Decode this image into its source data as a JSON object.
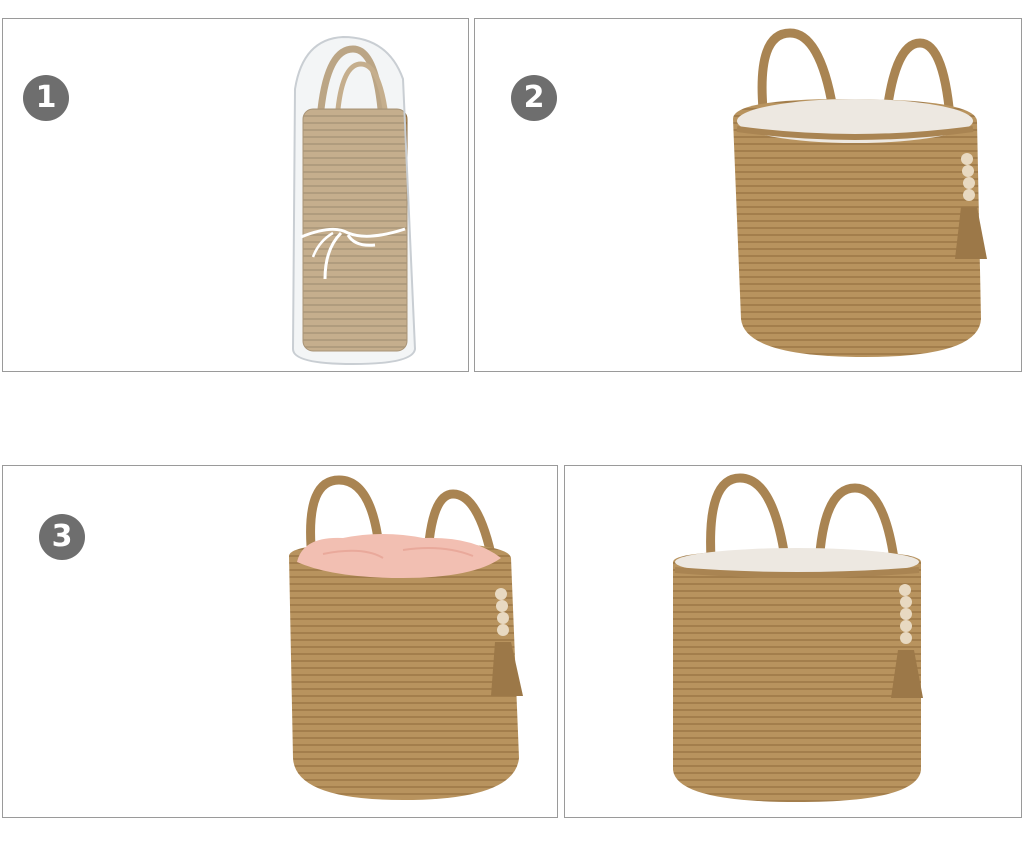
{
  "steps": {
    "step1": {
      "number": "1"
    },
    "step2": {
      "number": "2"
    },
    "step3": {
      "number": "3"
    }
  },
  "colors": {
    "badge": "#6e6e6e",
    "badge_text": "#ffffff",
    "jute": "#b8935e",
    "jute_dark": "#8d6a3c",
    "lining": "#ede8e1",
    "blanket": "#f2bfb2",
    "panel_border": "#9a9a9a"
  },
  "icons": {
    "packaged_basket": "packaged-basket-icon",
    "basket_with_tassel": "jute-basket-icon",
    "basket_with_blanket": "basket-with-blanket-icon"
  }
}
